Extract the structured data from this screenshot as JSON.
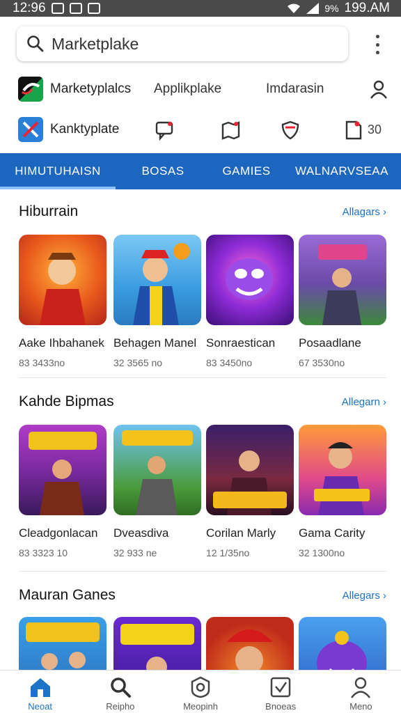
{
  "status_bar": {
    "time": "12:96",
    "battery_pct": "9%",
    "right_time": "199.AM"
  },
  "search": {
    "query": "Marketplake"
  },
  "shortcuts": [
    {
      "label": "Marketyplalcs",
      "links": [
        "Applikplake",
        "Imdarasin"
      ]
    },
    {
      "label": "Kanktyplate",
      "badge": "30"
    }
  ],
  "tabs": [
    {
      "label": "HIMUTUHAISN",
      "active": true
    },
    {
      "label": "BOSAS",
      "active": false
    },
    {
      "label": "GAMIES",
      "active": false
    },
    {
      "label": "WALNARVSEAA",
      "active": false
    }
  ],
  "sections": [
    {
      "title": "Hiburrain",
      "more": "Allagars",
      "items": [
        {
          "title": "Aake Ihbahanek",
          "sub": "83 3433no"
        },
        {
          "title": "Behagen Manel",
          "sub": "32 3565 no"
        },
        {
          "title": "Sonraestican",
          "sub": "83 3450no"
        },
        {
          "title": "Posaadlane",
          "sub": "67 3530no"
        }
      ]
    },
    {
      "title": "Kahde Bipmas",
      "more": "Allegarn",
      "items": [
        {
          "title": "Cleadgonlacan",
          "sub": "83 3323 10"
        },
        {
          "title": "Dveasdiva",
          "sub": "32 933 ne"
        },
        {
          "title": "Corilan Marly",
          "sub": "12 1/35no"
        },
        {
          "title": "Gama Carity",
          "sub": "32 1300no"
        }
      ]
    },
    {
      "title": "Mauran Ganes",
      "more": "Allegars",
      "items": [
        {
          "title": "",
          "sub": ""
        },
        {
          "title": "",
          "sub": ""
        },
        {
          "title": "",
          "sub": ""
        },
        {
          "title": "",
          "sub": ""
        }
      ]
    }
  ],
  "bottom_nav": [
    {
      "label": "Neoat",
      "icon": "home-icon",
      "active": true
    },
    {
      "label": "Reipho",
      "icon": "search-icon",
      "active": false
    },
    {
      "label": "Meopinh",
      "icon": "shield-icon",
      "active": false
    },
    {
      "label": "Bnoeas",
      "icon": "check-box-icon",
      "active": false
    },
    {
      "label": "Meno",
      "icon": "person-icon",
      "active": false
    }
  ],
  "colors": {
    "accent": "#1c66c0",
    "link": "#1a73c8"
  }
}
